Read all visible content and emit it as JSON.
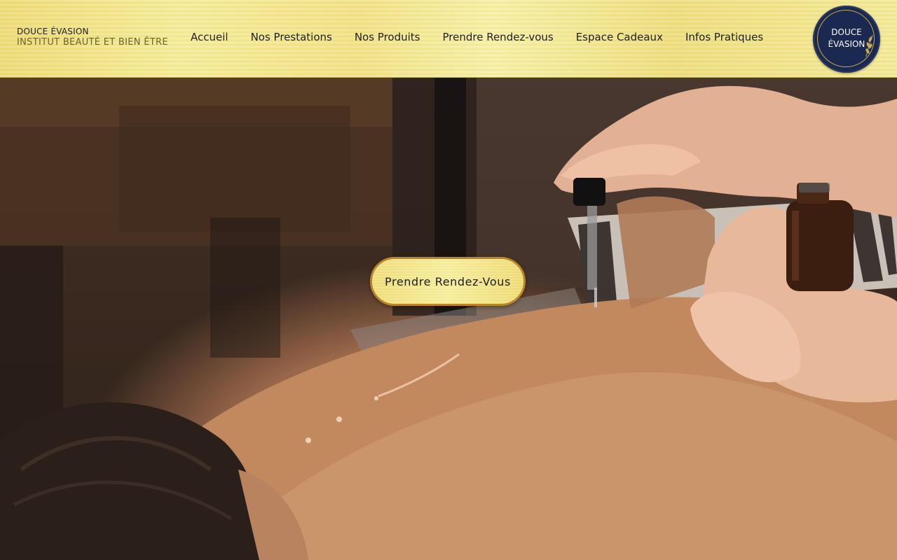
{
  "brand": {
    "name": "DOUCE ÉVASION",
    "tagline": "INSTITUT BEAUTÉ ET BIEN ÊTRE"
  },
  "nav": {
    "items": [
      {
        "label": "Accueil"
      },
      {
        "label": "Nos Prestations"
      },
      {
        "label": "Nos Produits"
      },
      {
        "label": "Prendre Rendez-vous"
      },
      {
        "label": "Espace Cadeaux"
      },
      {
        "label": "Infos Pratiques"
      }
    ]
  },
  "logo": {
    "line1": "DOUCE",
    "line2": "ÉVASION",
    "icon": "golden-leaf-icon"
  },
  "hero": {
    "image": "massage-oil-back-photo",
    "cta_label": "Prendre Rendez-Vous"
  },
  "colors": {
    "header_gold": "#f2e38a",
    "logo_navy": "#1b2850",
    "accent_gold": "#b8862a"
  }
}
